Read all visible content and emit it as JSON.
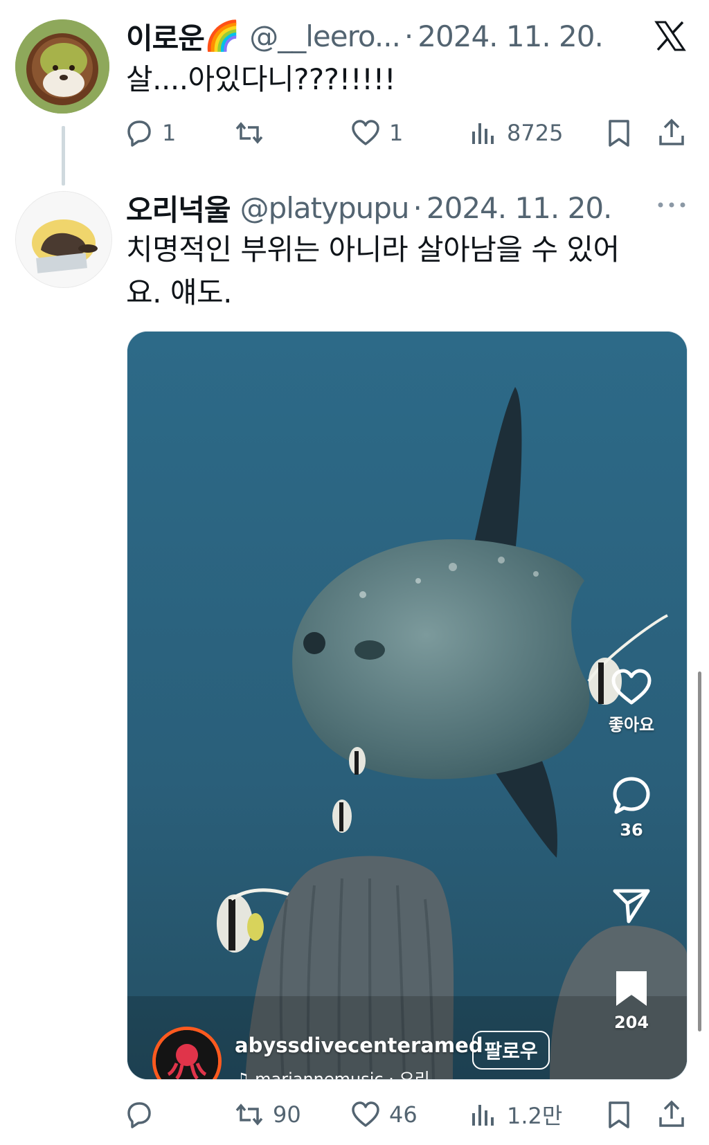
{
  "tweet1": {
    "author_name": "이로운",
    "name_emoji": "🌈",
    "handle": "@__leero...",
    "separator": "·",
    "date": "2024. 11. 20.",
    "text": "살....아있다니???!!!!!",
    "actions": {
      "reply_count": "1",
      "retweet_count": "",
      "like_count": "1",
      "view_count": "8725"
    }
  },
  "tweet2": {
    "author_name": "오리넉울",
    "handle": "@platypupu",
    "separator": "·",
    "date": "2024. 11. 20.",
    "text_line1": "치명적인 부위는 아니라 살아남을 수 있어",
    "text_line2": "요. 얘도.",
    "media": {
      "overlay_like_label": "좋아요",
      "overlay_comment_count": "36",
      "overlay_save_count": "204",
      "account_name": "abyssdivecenteramed",
      "music_text": "♫ mariannemusic · 오리",
      "follow_label": "팔로우"
    },
    "actions": {
      "reply_count": "",
      "retweet_count": "90",
      "like_count": "46",
      "view_count": "1.2만"
    }
  },
  "colors": {
    "text_primary": "#0f1419",
    "text_secondary": "#536471",
    "water": "#2f6782",
    "thread_line": "#cfd9de"
  },
  "icons": [
    "reply-icon",
    "retweet-icon",
    "like-icon",
    "views-icon",
    "bookmark-icon",
    "share-icon",
    "x-logo-icon",
    "more-icon"
  ]
}
